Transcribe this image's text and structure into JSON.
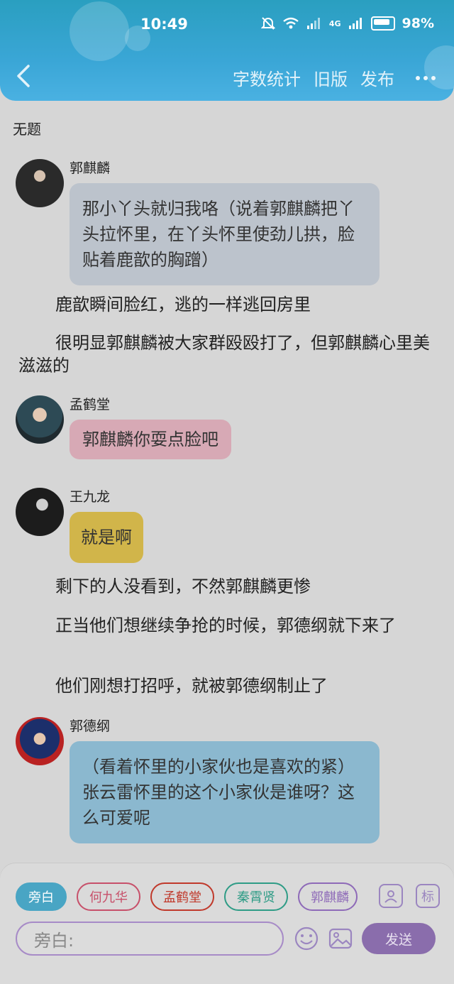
{
  "status_bar": {
    "time": "10:49",
    "network": "4G",
    "battery": "98%"
  },
  "header": {
    "actions": [
      "字数统计",
      "旧版",
      "发布"
    ]
  },
  "document": {
    "title": "无题"
  },
  "messages": [
    {
      "speaker": "郭麒麟",
      "text": "那小丫头就归我咯（说着郭麒麟把丫头拉怀里，在丫头怀里使劲儿拱，脸贴着鹿歆的胸蹭）"
    },
    {
      "narration": "鹿歆瞬间脸红，逃的一样逃回房里"
    },
    {
      "narration": "很明显郭麒麟被大家群殴殴打了，但郭麒麟心里美滋滋的"
    },
    {
      "speaker": "孟鹤堂",
      "text": "郭麒麟你耍点脸吧"
    },
    {
      "speaker": "王九龙",
      "text": "就是啊"
    },
    {
      "narration": "剩下的人没看到，不然郭麒麟更惨"
    },
    {
      "narration": "正当他们想继续争抢的时候，郭德纲就下来了"
    },
    {
      "narration": "他们刚想打招呼，就被郭德纲制止了"
    },
    {
      "speaker": "郭德纲",
      "text": "（看着怀里的小家伙也是喜欢的紧）张云雷怀里的这个小家伙是谁呀？这么可爱呢"
    }
  ],
  "composer": {
    "chips": [
      {
        "label": "旁白",
        "color": "#49a5c4",
        "active": true
      },
      {
        "label": "何九华",
        "color": "#c7506a"
      },
      {
        "label": "孟鹤堂",
        "color": "#c0392b"
      },
      {
        "label": "秦霄贤",
        "color": "#2f9c86"
      },
      {
        "label": "郭麒麟",
        "color": "#8e6ab8"
      }
    ],
    "tag_button": "标",
    "input_placeholder": "旁白:",
    "send_label": "发送"
  }
}
